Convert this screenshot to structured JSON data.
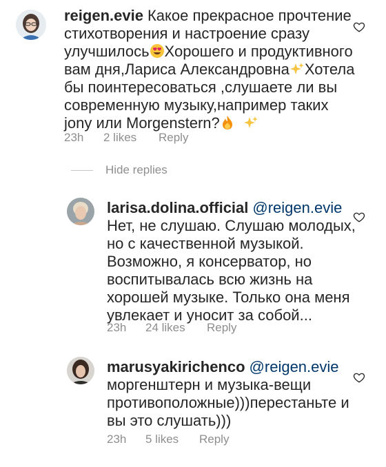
{
  "comments": [
    {
      "username": "reigen.evie",
      "text_line1": "Какое прекрасное прочтение",
      "text_line2": "стихотворения и настроение сразу",
      "text_line3a": "улучшилось",
      "text_line3b": "Хорошего и продуктивного",
      "text_line4a": "вам дня,Лариса Александровна",
      "text_line4b": "Хотела",
      "text_line5": "бы поинтересоваться ,слушаете ли вы",
      "text_line6": "современную музыку,например таких",
      "text_line7": "jony или Morgenstern?",
      "time": "23h",
      "likes": "2 likes",
      "reply": "Reply"
    }
  ],
  "hide_replies": "Hide replies",
  "replies": [
    {
      "username": "larisa.dolina.official",
      "mention": "@reigen.evie",
      "lines": [
        "Нет, не слушаю. Слушаю молодых,",
        "но с качественной музыкой.",
        "Возможно, я консерватор, но",
        "воспитывалась всю жизнь на",
        "хорошей музыке. Только она меня",
        "увлекает и уносит за собой..."
      ],
      "time": "23h",
      "likes": "24 likes",
      "reply": "Reply"
    },
    {
      "username": "marusyakirichenco",
      "mention": "@reigen.evie",
      "lines": [
        "моргенштерн и музыка-вещи",
        "противоположные)))перестаньте и",
        "вы это слушать)))"
      ],
      "time": "23h",
      "likes": "5 likes",
      "reply": "Reply"
    }
  ],
  "icons": {
    "like": "heart-outline-icon",
    "emoji_love": "heart-eyes-emoji",
    "emoji_sparkles": "sparkles-emoji",
    "emoji_fire": "fire-emoji"
  }
}
